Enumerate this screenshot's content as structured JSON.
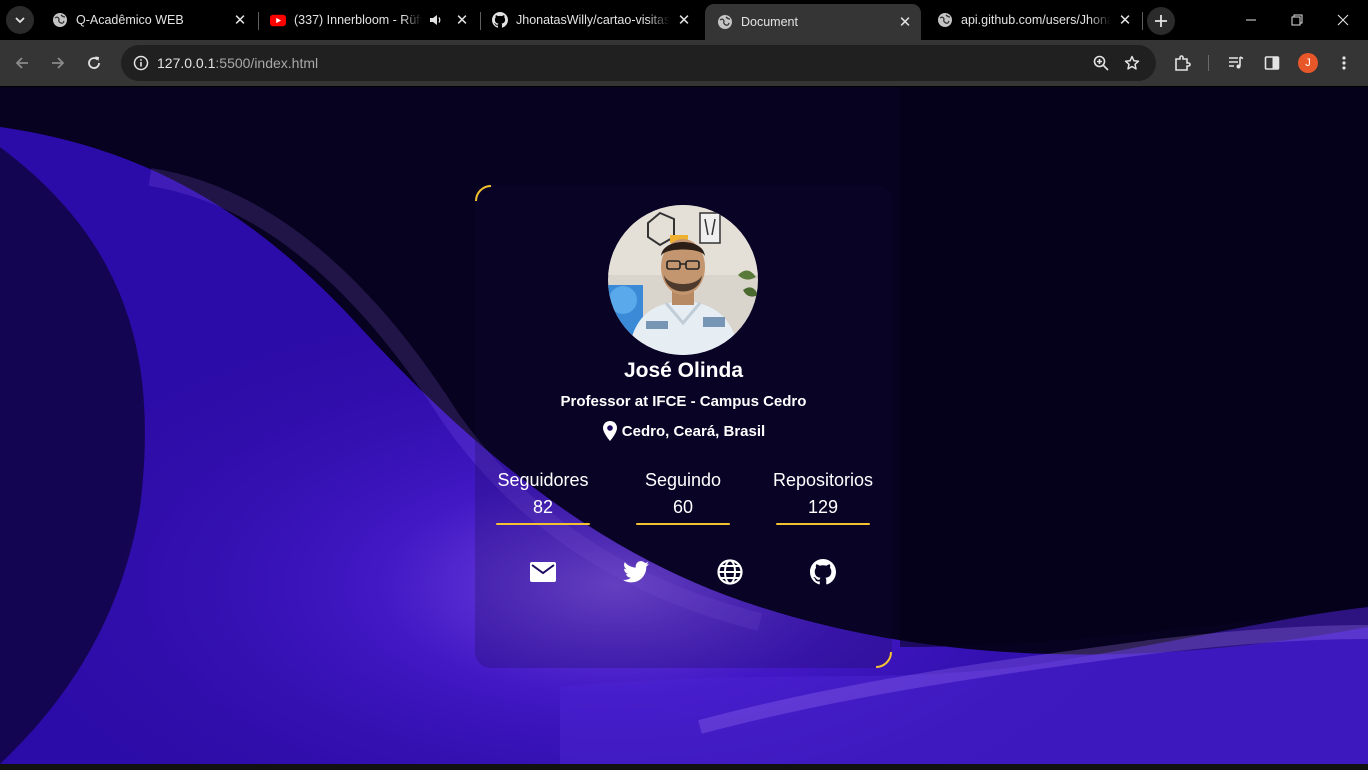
{
  "browser": {
    "tabs": [
      {
        "title": "Q-Acadêmico WEB",
        "favicon": "globe-icon",
        "active": false
      },
      {
        "title": "(337) Innerbloom - Rüfüs",
        "favicon": "youtube-icon",
        "active": false,
        "audio": true
      },
      {
        "title": "JhonatasWilly/cartao-visitas",
        "favicon": "github-icon",
        "active": false
      },
      {
        "title": "Document",
        "favicon": "globe-icon",
        "active": true
      },
      {
        "title": "api.github.com/users/Jhonat",
        "favicon": "globe-icon",
        "active": false
      }
    ],
    "address": {
      "host": "127.0.0.1",
      "rest": ":5500/index.html"
    },
    "profile_initial": "J"
  },
  "profile": {
    "name": "José Olinda",
    "bio": "Professor at IFCE - Campus Cedro",
    "location": "Cedro, Ceará, Brasil",
    "stats": [
      {
        "label": "Seguidores",
        "value": "82"
      },
      {
        "label": "Seguindo",
        "value": "60"
      },
      {
        "label": "Repositorios",
        "value": "129"
      }
    ],
    "socials": [
      "mail-icon",
      "twitter-icon",
      "globe-icon",
      "github-icon"
    ]
  },
  "colors": {
    "accent_border": "#f2c230",
    "background_deep": "#06021a",
    "background_purple": "#3a10c8"
  }
}
